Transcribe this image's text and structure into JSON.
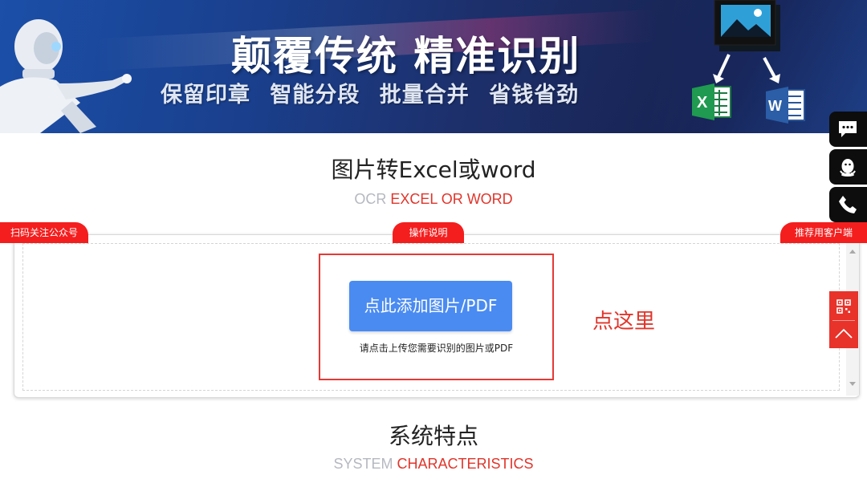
{
  "banner": {
    "title": "颠覆传统 精准识别",
    "subtitle": "保留印章 智能分段 批量合并 省钱省劲"
  },
  "section1": {
    "title": "图片转Excel或word",
    "sub_grey": "OCR",
    "sub_red": "EXCEL OR WORD"
  },
  "tabs": {
    "left": "扫码关注公众号",
    "center": "操作说明",
    "right": "推荐用客户端"
  },
  "upload": {
    "button_label": "点此添加图片/PDF",
    "hint": "请点击上传您需要识别的图片或PDF",
    "annotation": "点这里"
  },
  "section2": {
    "title": "系统特点",
    "sub_grey": "SYSTEM",
    "sub_red": "CHARACTERISTICS"
  },
  "floating": [
    "chat-icon",
    "qq-icon",
    "phone-icon"
  ],
  "side_tools": [
    "qrcode-icon",
    "back-to-top-icon"
  ],
  "colors": {
    "accent_red": "#e0352b",
    "tab_red": "#f41e1e",
    "button_blue": "#4a8bf2",
    "banner_blue": "#1a3f8c"
  }
}
